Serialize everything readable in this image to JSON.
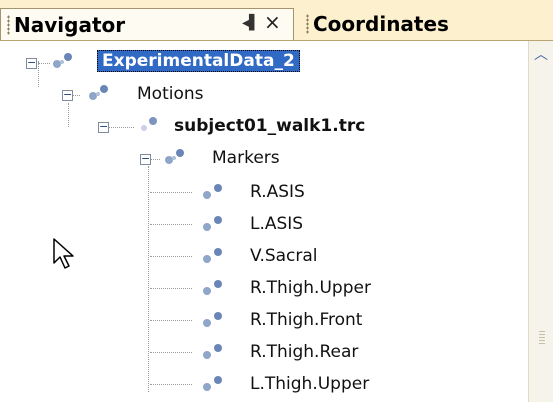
{
  "tabs": {
    "navigator": "Navigator",
    "coordinates": "Coordinates",
    "pin_glyph": "◂▌",
    "close_glyph": "×"
  },
  "tree": {
    "root": "ExperimentalData_2",
    "motions": "Motions",
    "file": "subject01_walk1.trc",
    "markers": "Markers",
    "marker_items": [
      "R.ASIS",
      "L.ASIS",
      "V.Sacral",
      "R.Thigh.Upper",
      "R.Thigh.Front",
      "R.Thigh.Rear",
      "L.Thigh.Upper"
    ]
  },
  "colors": {
    "selection": "#316ac5",
    "tab_bar": "#fdf0cf"
  },
  "icons": {
    "node": "sphere-node-icon",
    "expand": "minus-box-icon"
  }
}
